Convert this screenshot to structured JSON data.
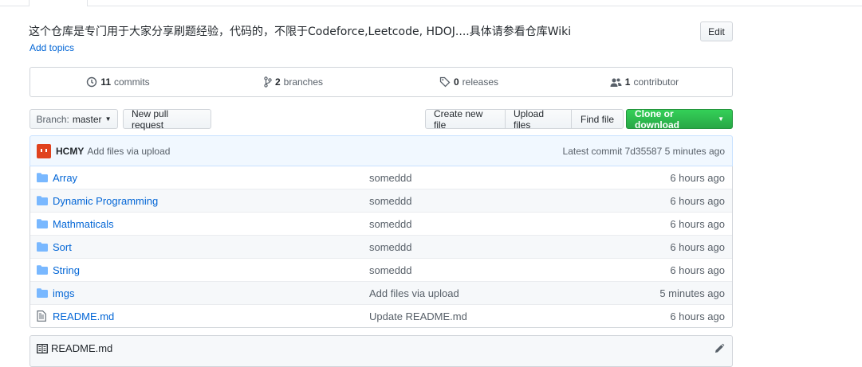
{
  "repo": {
    "description": "这个仓库是专门用于大家分享刷题经验，代码的，不限于Codeforce,Leetcode, HDOJ....具体请参看仓库Wiki",
    "add_topics": "Add topics",
    "edit_label": "Edit"
  },
  "summary": {
    "commits_count": "11",
    "commits_label": "commits",
    "branches_count": "2",
    "branches_label": "branches",
    "releases_count": "0",
    "releases_label": "releases",
    "contributors_count": "1",
    "contributors_label": "contributor"
  },
  "toolbar": {
    "branch_label": "Branch:",
    "branch_value": "master",
    "new_pull_request": "New pull request",
    "create_new_file": "Create new file",
    "upload_files": "Upload files",
    "find_file": "Find file",
    "clone_or_download": "Clone or download"
  },
  "latest_commit": {
    "author": "HCMY",
    "message": "Add files via upload",
    "info": "Latest commit 7d35587 5 minutes ago"
  },
  "files": [
    {
      "name": "Array",
      "type": "folder",
      "message": "someddd",
      "age": "6 hours ago"
    },
    {
      "name": "Dynamic Programming",
      "type": "folder",
      "message": "someddd",
      "age": "6 hours ago"
    },
    {
      "name": "Mathmaticals",
      "type": "folder",
      "message": "someddd",
      "age": "6 hours ago"
    },
    {
      "name": "Sort",
      "type": "folder",
      "message": "someddd",
      "age": "6 hours ago"
    },
    {
      "name": "String",
      "type": "folder",
      "message": "someddd",
      "age": "6 hours ago"
    },
    {
      "name": "imgs",
      "type": "folder",
      "message": "Add files via upload",
      "age": "5 minutes ago"
    },
    {
      "name": "README.md",
      "type": "file",
      "message": "Update README.md",
      "age": "6 hours ago"
    }
  ],
  "readme": {
    "title": "README.md"
  },
  "colors": {
    "link": "#0366d6",
    "clone_button": "#28a745",
    "commit_bar": "#f1f8ff",
    "avatar": "#e0421e"
  }
}
